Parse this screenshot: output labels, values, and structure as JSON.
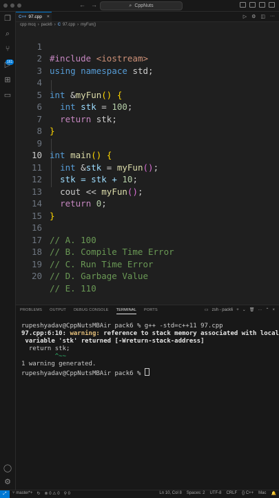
{
  "titlebar": {
    "search_text": "CppNuts"
  },
  "tab": {
    "label": "97.cpp",
    "icon": "C++"
  },
  "breadcrumb": [
    "cpp mcq",
    "pack6",
    "97.cpp",
    "myFun()"
  ],
  "code": {
    "lines": [
      {
        "n": "1"
      },
      {
        "n": "2"
      },
      {
        "n": "3"
      },
      {
        "n": "4"
      },
      {
        "n": "5"
      },
      {
        "n": "6"
      },
      {
        "n": "7"
      },
      {
        "n": "8"
      },
      {
        "n": "9"
      },
      {
        "n": "10"
      },
      {
        "n": "11"
      },
      {
        "n": "12"
      },
      {
        "n": "13"
      },
      {
        "n": "14"
      },
      {
        "n": "15"
      },
      {
        "n": "16"
      },
      {
        "n": "17"
      },
      {
        "n": "18"
      },
      {
        "n": "19"
      },
      {
        "n": "20"
      }
    ],
    "t": {
      "include": "#include",
      "header": "<iostream>",
      "using": "using",
      "namespace": "namespace",
      "std": "std;",
      "int": "int",
      "amp": "&",
      "myFun": "myFun",
      "parens": "()",
      "brace_open": "{",
      "brace_close": "}",
      "stk": "stk",
      "eq100": " = ",
      "n100": "100",
      "semi": ";",
      "return": "return",
      "stk_semi": "stk;",
      "main": "main",
      "l11a": "stk = stk + ",
      "n10": "10",
      "cout": "cout << ",
      "n0": "0",
      "optA": "// A. 100",
      "optB": "// B. Compile Time Error",
      "optC": "// C. Run Time Error",
      "optD": "// D. Garbage Value",
      "optE": "// E. 110"
    }
  },
  "panel": {
    "tabs": [
      "PROBLEMS",
      "OUTPUT",
      "DEBUG CONSOLE",
      "TERMINAL",
      "PORTS"
    ],
    "active_tab": "TERMINAL",
    "terminal_name": "zsh - pack6",
    "terminal": {
      "l1": "rupeshyadav@CppNutsMBAir pack6 % g++ -std=c++11 97.cpp",
      "l2a": "97.cpp:6:10: ",
      "l2b": "warning: ",
      "l2c": "reference to stack memory associated with local",
      "l3": " variable 'stk' returned [-Wreturn-stack-address]",
      "l4": "  return stk;",
      "l5": "         ^~~",
      "l6": "1 warning generated.",
      "l7": "rupeshyadav@CppNutsMBAir pack6 % "
    }
  },
  "statusbar": {
    "branch": "master*+",
    "errors": "0",
    "warnings": "0",
    "ports": "0",
    "position": "Ln 10, Col 8",
    "spaces": "Spaces: 2",
    "encoding": "UTF-8",
    "eol": "CRLF",
    "language": "C++",
    "platform": "Mac"
  },
  "activity_badge": "161",
  "colors": {
    "accent": "#0078d4",
    "keyword": "#569cd6",
    "function": "#dcdcaa",
    "number": "#b5cea8",
    "comment": "#6a9955",
    "warning": "#e5c07b"
  }
}
